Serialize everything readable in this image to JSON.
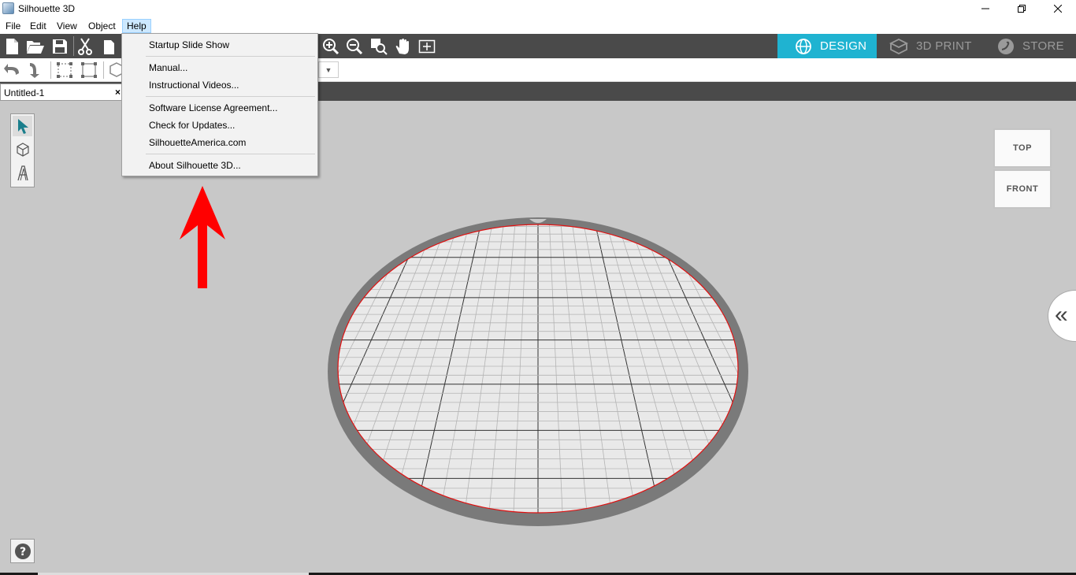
{
  "window": {
    "title": "Silhouette 3D"
  },
  "menubar": {
    "file": "File",
    "edit": "Edit",
    "view": "View",
    "object": "Object",
    "help": "Help"
  },
  "help_menu": {
    "items": [
      "Startup Slide Show",
      "Manual...",
      "Instructional Videos...",
      "Software License Agreement...",
      "Check for Updates...",
      "SilhouetteAmerica.com",
      "About Silhouette 3D..."
    ]
  },
  "mode_tabs": {
    "design": "DESIGN",
    "print": "3D PRINT",
    "store": "STORE"
  },
  "document": {
    "tab_name": "Untitled-1",
    "close": "×"
  },
  "view_cube": {
    "top": "TOP",
    "front": "FRONT"
  },
  "panel_toggle": "«",
  "help_button": "?",
  "dropdown_arrow": "▼",
  "colors": {
    "accent": "#1fb3d1",
    "toolbar": "#4a4a4a",
    "canvas": "#c8c8c8",
    "bed_rim": "#7a7a7a",
    "bed_outline": "#e01010",
    "arrow": "#ff0000"
  }
}
